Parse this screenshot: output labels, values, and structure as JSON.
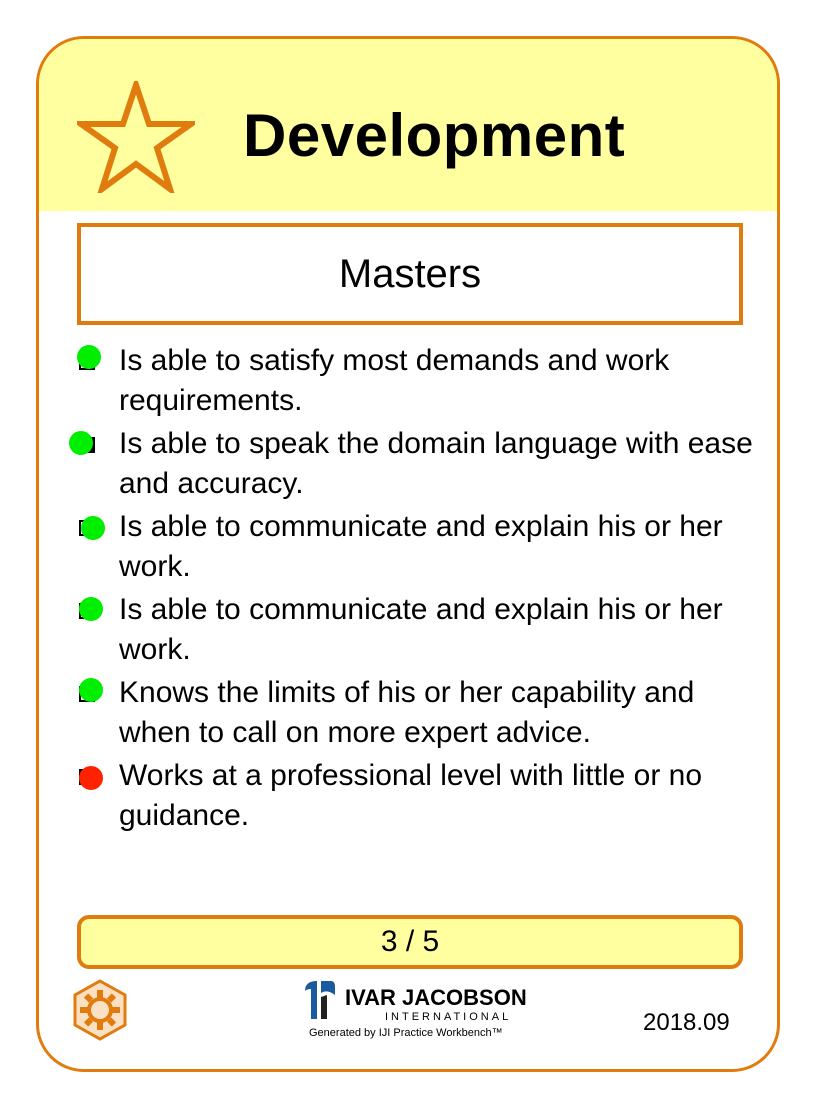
{
  "card": {
    "title": "Development",
    "state": "Masters",
    "progress": "3 / 5",
    "version": "2018.09"
  },
  "checklist": [
    {
      "text": "Is able to satisfy most demands and work requirements.",
      "status": "green",
      "box_filled": false
    },
    {
      "text": "Is able to speak the domain language with ease and accuracy.",
      "status": "green",
      "box_filled": true
    },
    {
      "text": "Is able to communicate and explain his or her work.",
      "status": "green",
      "box_filled": false
    },
    {
      "text": "Is able to communicate and explain his or her work.",
      "status": "green",
      "box_filled": false
    },
    {
      "text": "Knows the limits of his or her capability and when to call on more expert advice.",
      "status": "green",
      "box_filled": false
    },
    {
      "text": "Works at a professional level with little or no guidance.",
      "status": "red",
      "box_filled": false
    }
  ],
  "footer": {
    "logo_name": "IVAR JACOBSON",
    "logo_sub": "INTERNATIONAL",
    "generated": "Generated by IJI Practice Workbench™"
  },
  "colors": {
    "accent": "#e07b0e",
    "header_bg": "#ffffa0",
    "green": "#00ee00",
    "red": "#ff2200",
    "logo_blue": "#1a5aa0"
  },
  "icons": {
    "header": "star-icon",
    "footer": "gear-icon"
  }
}
